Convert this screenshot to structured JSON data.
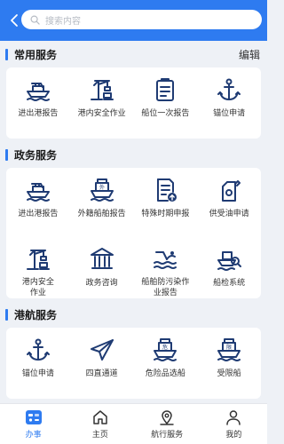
{
  "search": {
    "placeholder": "搜索内容"
  },
  "sections": {
    "common": {
      "title": "常用服务",
      "edit_label": "编辑",
      "items": [
        {
          "label": "进出港报告",
          "icon": "ship-icon"
        },
        {
          "label": "港内安全作业",
          "icon": "crane-icon"
        },
        {
          "label": "船位一次报告",
          "icon": "clipboard-icon"
        },
        {
          "label": "锚位申请",
          "icon": "anchor-icon"
        }
      ]
    },
    "gov": {
      "title": "政务服务",
      "items": [
        {
          "label": "进出港报告",
          "icon": "ship-icon"
        },
        {
          "label": "外籍船舶报告",
          "icon": "foreign-ship-icon"
        },
        {
          "label": "特殊时期申报",
          "icon": "document-upload-icon"
        },
        {
          "label": "供受油申请",
          "icon": "fuel-can-icon"
        },
        {
          "label": "港内安全作业",
          "icon": "crane-icon"
        },
        {
          "label": "政务咨询",
          "icon": "government-building-icon"
        },
        {
          "label": "船舶防污染作业报告",
          "icon": "pollution-wave-icon"
        },
        {
          "label": "船检系统",
          "icon": "ship-inspection-icon"
        }
      ]
    },
    "port": {
      "title": "港航服务",
      "items": [
        {
          "label": "锚位申请",
          "icon": "anchor-icon"
        },
        {
          "label": "四直通道",
          "icon": "paper-plane-icon"
        },
        {
          "label": "危险品选船",
          "icon": "hazard-ship-icon"
        },
        {
          "label": "受限船",
          "icon": "restricted-ship-icon"
        }
      ]
    }
  },
  "tabs": [
    {
      "label": "办事",
      "icon": "services-icon",
      "active": true
    },
    {
      "label": "主页",
      "icon": "home-icon",
      "active": false
    },
    {
      "label": "航行服务",
      "icon": "location-pin-icon",
      "active": false
    },
    {
      "label": "我的",
      "icon": "user-icon",
      "active": false
    }
  ],
  "colors": {
    "accent": "#2e7bf0",
    "icon_navy": "#1f3b73",
    "background": "#eef1f6"
  }
}
